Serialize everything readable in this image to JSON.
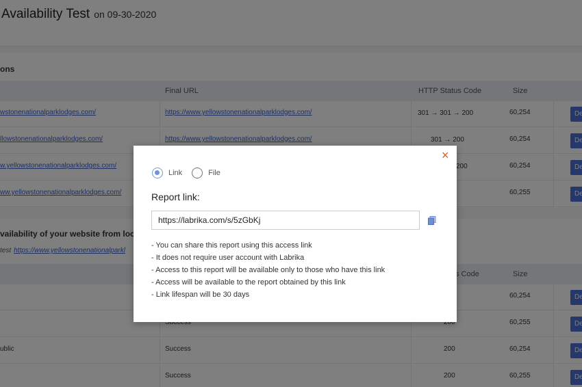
{
  "page": {
    "title": "Availability Test",
    "date": "on 09-30-2020",
    "section1": {
      "title": "ons",
      "columns": [
        "Final URL",
        "HTTP Status Code",
        "Size"
      ],
      "rows": [
        {
          "url": "wstonenationalparklodges.com/",
          "final_url": "https://www.yellowstonenationalparklodges.com/",
          "status": "301 → 301 → 200",
          "size": "60,254",
          "btn": "De"
        },
        {
          "url": "llowstonenationalparklodges.com/",
          "final_url": "https://www.yellowstonenationalparklodges.com/",
          "status": "301 → 200",
          "size": "60,254",
          "btn": "De"
        },
        {
          "url": "w.yellowstonenationalparklodges.com/",
          "final_url": "",
          "status": "200",
          "size": "60,254",
          "btn": "De"
        },
        {
          "url": "ww.yellowstonenationalparklodges.com/",
          "final_url": "",
          "status": "",
          "size": "60,255",
          "btn": "De"
        }
      ]
    },
    "section2": {
      "title": "vailability of your website from locat",
      "sub_prefix": "test",
      "sub_link": "https://www.yellowstonenationalparkl",
      "columns": [
        "s Code",
        "Size"
      ],
      "rows": [
        {
          "loc": "",
          "result": "",
          "status": "",
          "size": "60,254",
          "btn": "De"
        },
        {
          "loc": "",
          "result": "Success",
          "status": "200",
          "size": "60,255",
          "btn": "De"
        },
        {
          "loc": "ublic",
          "result": "Success",
          "status": "200",
          "size": "60,254",
          "btn": "De"
        },
        {
          "loc": "",
          "result": "Success",
          "status": "200",
          "size": "60,255",
          "btn": "De"
        }
      ]
    }
  },
  "modal": {
    "close": "×",
    "radio_link": "Link",
    "radio_file": "File",
    "report_label": "Report link:",
    "link_value": "https://labrika.com/s/5zGbKj",
    "notes": [
      "You can share this report using this access link",
      "It does not require user account with Labrika",
      "Access to this report will be available only to those who have this link",
      "Access will be available to the report obtained by this link",
      "Link lifespan will be 30 days"
    ]
  },
  "colors": {
    "accent": "#4a6fd6",
    "close": "#e0561b",
    "radio": "#6f93d6"
  },
  "icons": {
    "copy": "copy-icon",
    "close": "close-icon"
  }
}
